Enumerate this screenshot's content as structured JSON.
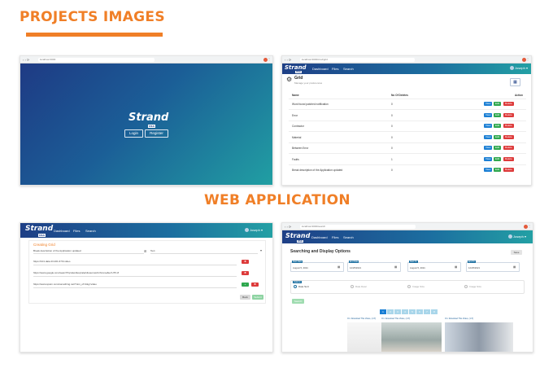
{
  "headings": {
    "top": "PROJECTS IMAGES",
    "middle": "WEB APPLICATION"
  },
  "colors": {
    "accent": "#f07f27",
    "gradient_start": "#1e3f86",
    "gradient_end": "#23a0a4",
    "view": "#1b7fd4",
    "edit": "#2fa84f",
    "delete": "#dd3a3a"
  },
  "shot1": {
    "url": "localhost:3000",
    "logo": "Strand",
    "logo_sub": "USA",
    "login": "Login",
    "register": "Register"
  },
  "shot2": {
    "url": "localhost:3000/crud/grid",
    "logo": "Strand",
    "logo_sub": "USA",
    "nav": [
      "Dashboard",
      "Files",
      "Search"
    ],
    "user": "Joseph",
    "title": "Grid",
    "subtitle": "Manage your preferences",
    "columns": {
      "name": "Name",
      "deleted": "No Of Deletes",
      "action": "Action"
    },
    "rows": [
      {
        "name": "Word found patched notification",
        "count": "0"
      },
      {
        "name": "Error",
        "count": "0"
      },
      {
        "name": "Contractor",
        "count": "0"
      },
      {
        "name": "Material",
        "count": "0"
      },
      {
        "name": "Between Error",
        "count": "0"
      },
      {
        "name": "Faults",
        "count": "1"
      },
      {
        "name": "Break description of the Application updated",
        "count": "0"
      }
    ],
    "view": "View",
    "edit": "Edit",
    "delete": "Delete"
  },
  "shot3": {
    "logo": "Strand",
    "logo_sub": "USA",
    "nav": [
      "Dashboard",
      "Files",
      "Search"
    ],
    "user": "Joseph",
    "title": "Creating Grid",
    "name_value": "Break description of the Application updated",
    "type_value": "Text",
    "urls": [
      "https://101.data 23.201.67/0.video",
      "https://www.google.com/search?q=alert&oq=alert&sourceid=chrome&ie=UTF-8",
      "https://www.spwm.com/something.net/?utm_of=1&g=video"
    ],
    "back": "Back",
    "submit": "Submit"
  },
  "shot4": {
    "url": "localhost:3000/search",
    "logo": "Strand",
    "logo_sub": "USA",
    "nav": [
      "Dashboard",
      "Files",
      "Search"
    ],
    "user": "Joseph",
    "title": "Searching and Display Options",
    "save": "Save",
    "date_labels": [
      "Start Date",
      "End Date",
      "Start To",
      "End To"
    ],
    "date_values": [
      "August 5, 2021",
      "12/25/2021",
      "August 5, 2021",
      "12/25/2021"
    ],
    "options_label": "Options",
    "options": [
      "Date Sort",
      "Date Desc",
      "Image Size",
      "Image Size"
    ],
    "search": "Search",
    "pages": [
      "1",
      "2",
      "3",
      "4",
      "5",
      "6",
      "7",
      "8"
    ],
    "captions": [
      "On: Download This Video, (1 P)",
      "On: Download This Video, (1 P)",
      "On: Download This Video, (1 P)"
    ]
  }
}
